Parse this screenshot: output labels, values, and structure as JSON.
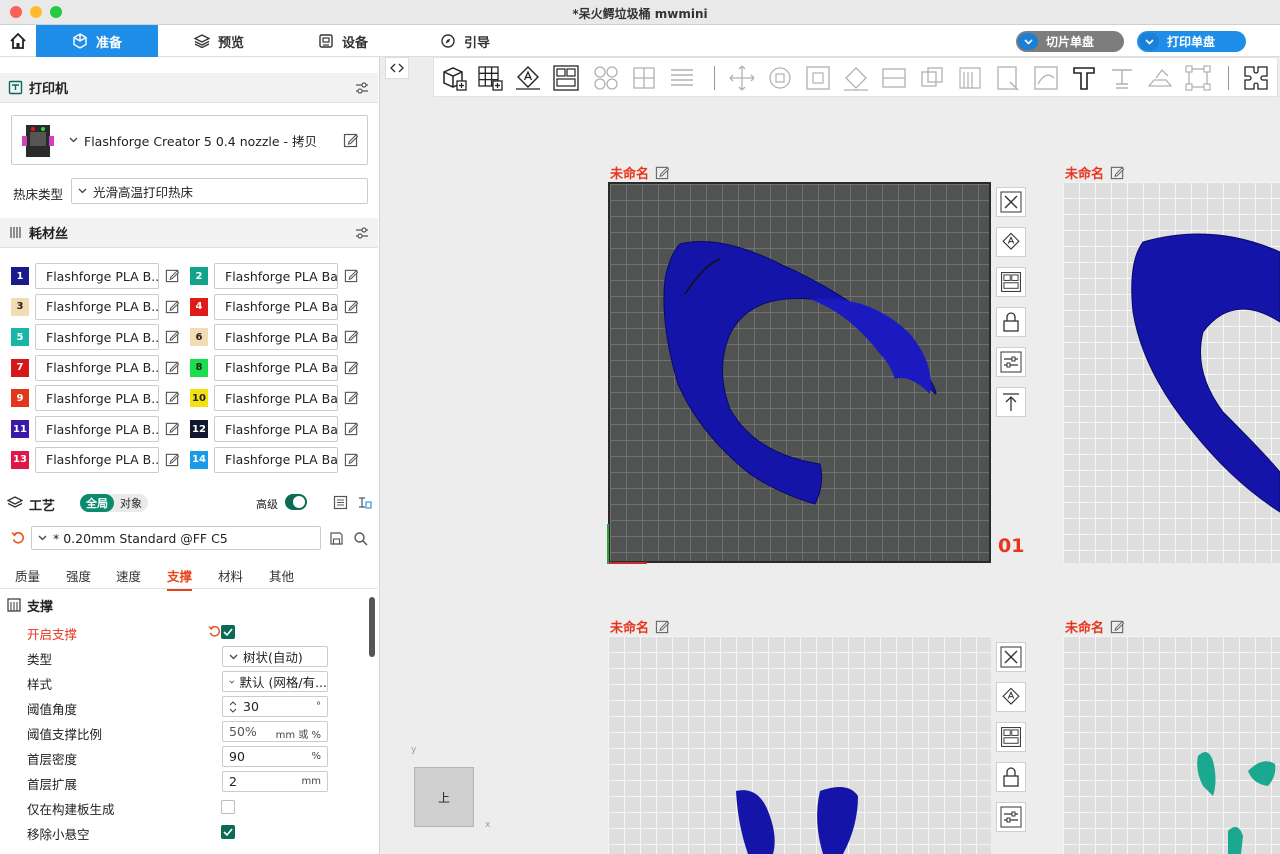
{
  "window": {
    "title": "*呆火鳄垃圾桶 mwmini"
  },
  "nav": {
    "tabs": [
      {
        "label": "准备"
      },
      {
        "label": "预览"
      },
      {
        "label": "设备"
      },
      {
        "label": "引导"
      }
    ],
    "slice_label": "切片单盘",
    "print_label": "打印单盘"
  },
  "printer": {
    "section_title": "打印机",
    "name": "Flashforge Creator 5 0.4 nozzle - 拷贝",
    "bed_label": "热床类型",
    "bed_value": "光滑高温打印热床"
  },
  "filament": {
    "section_title": "耗材丝",
    "items": [
      {
        "num": "1",
        "color": "#1a1a8c",
        "name": "Flashforge PLA B..."
      },
      {
        "num": "2",
        "color": "#12a48a",
        "name": "Flashforge PLA Ba..."
      },
      {
        "num": "3",
        "color": "#f3dcb4",
        "name": "Flashforge PLA B..."
      },
      {
        "num": "4",
        "color": "#e01919",
        "name": "Flashforge PLA Ba..."
      },
      {
        "num": "5",
        "color": "#17b6a6",
        "name": "Flashforge PLA B..."
      },
      {
        "num": "6",
        "color": "#f3dcb4",
        "name": "Flashforge PLA Ba..."
      },
      {
        "num": "7",
        "color": "#d81818",
        "name": "Flashforge PLA B..."
      },
      {
        "num": "8",
        "color": "#19e04a",
        "name": "Flashforge PLA Ba..."
      },
      {
        "num": "9",
        "color": "#e0381a",
        "name": "Flashforge PLA B..."
      },
      {
        "num": "10",
        "color": "#f2e20e",
        "name": "Flashforge PLA Ba..."
      },
      {
        "num": "11",
        "color": "#3a1aa8",
        "name": "Flashforge PLA B..."
      },
      {
        "num": "12",
        "color": "#101830",
        "name": "Flashforge PLA Ba..."
      },
      {
        "num": "13",
        "color": "#e0184a",
        "name": "Flashforge PLA B..."
      },
      {
        "num": "14",
        "color": "#1a9ae8",
        "name": "Flashforge PLA Ba..."
      }
    ]
  },
  "process": {
    "section_title": "工艺",
    "toggle_global": "全局",
    "toggle_object": "对象",
    "advanced_label": "高级",
    "preset": "* 0.20mm Standard @FF C5",
    "tabs": [
      "质量",
      "强度",
      "速度",
      "支撑",
      "材料",
      "其他"
    ],
    "active_tab": "支撑",
    "support_title": "支撑",
    "params": {
      "enable": {
        "label": "开启支撑",
        "checked": true
      },
      "type": {
        "label": "类型",
        "value": "树状(自动)"
      },
      "style": {
        "label": "样式",
        "value": "默认 (网格/有..."
      },
      "threshold_angle": {
        "label": "阈值角度",
        "value": "30",
        "unit": "°"
      },
      "threshold_ratio": {
        "label": "阈值支撑比例",
        "value": "50%",
        "unit": "mm 或 %"
      },
      "first_density": {
        "label": "首层密度",
        "value": "90",
        "unit": "%"
      },
      "first_expand": {
        "label": "首层扩展",
        "value": "2",
        "unit": "mm"
      },
      "buildplate_only": {
        "label": "仅在构建板生成",
        "checked": false
      },
      "remove_small": {
        "label": "移除小悬空",
        "checked": true
      }
    }
  },
  "viewport": {
    "plates": [
      {
        "name": "未命名",
        "number": "01"
      },
      {
        "name": "未命名"
      },
      {
        "name": "未命名"
      },
      {
        "name": "未命名"
      }
    ],
    "view_cube_label": "上",
    "axis_y": "y",
    "axis_x": "x"
  },
  "colors": {
    "accent": "#1f8ee8",
    "highlight": "#e8341c",
    "model_blue": "#1414a8",
    "model_teal": "#1aa88e",
    "check": "#0b6b57"
  }
}
